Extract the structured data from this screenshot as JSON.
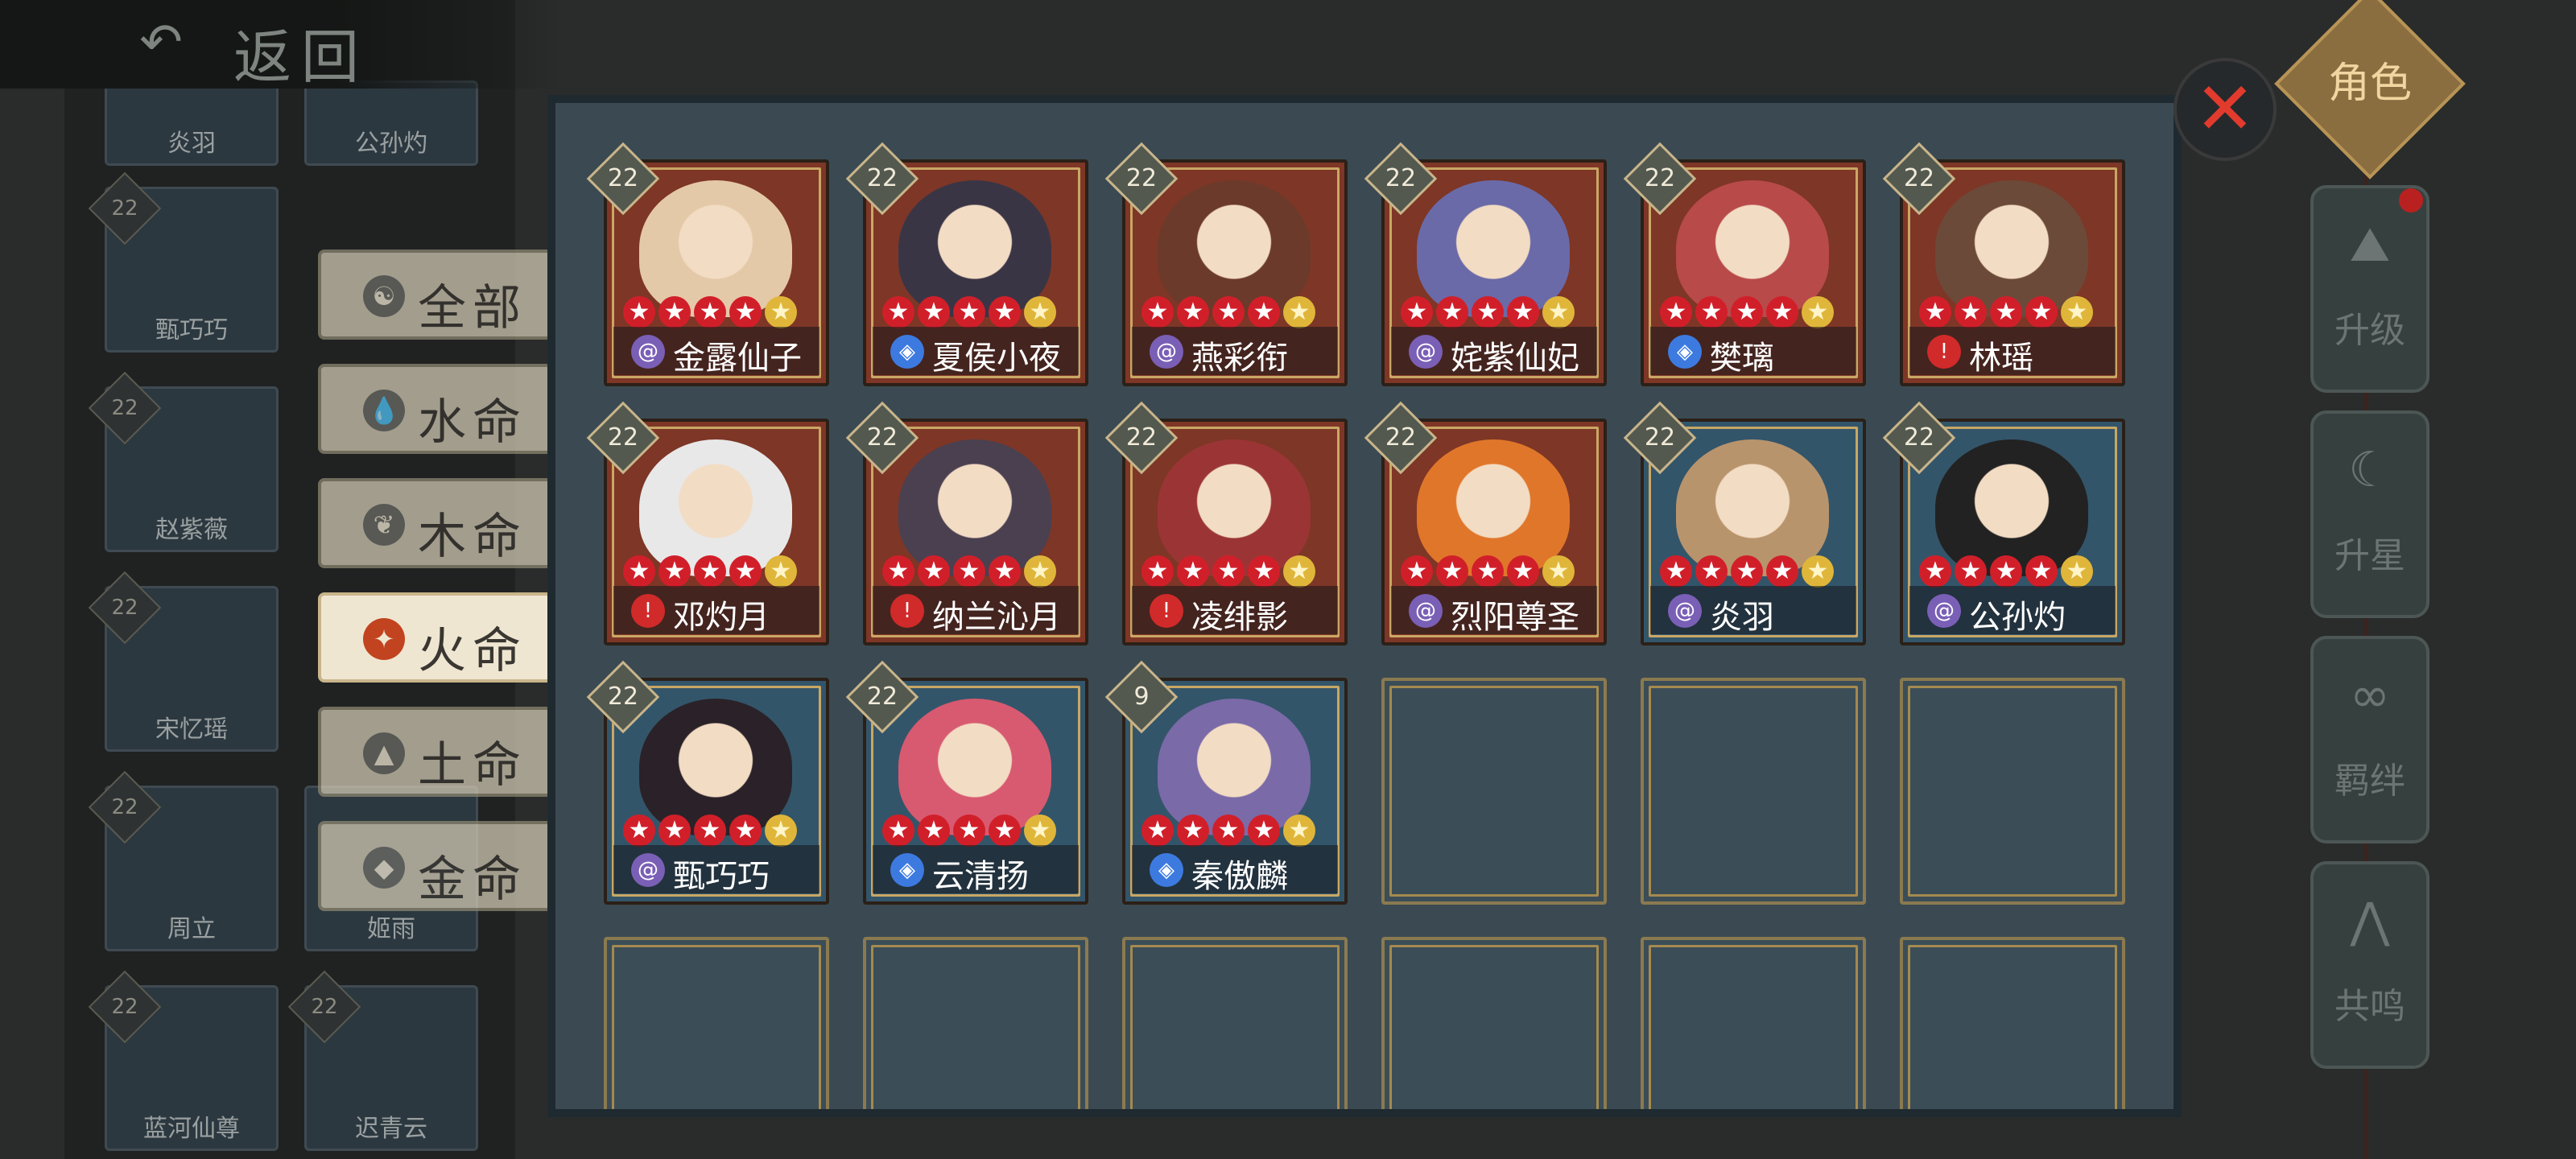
{
  "header": {
    "back_label": "返回"
  },
  "filter_tabs": [
    {
      "label": "全部",
      "icon": "yin-yang-icon",
      "active": false
    },
    {
      "label": "水命",
      "icon": "water-drop-icon",
      "active": false
    },
    {
      "label": "木命",
      "icon": "leaf-icon",
      "active": false
    },
    {
      "label": "火命",
      "icon": "flame-icon",
      "active": true
    },
    {
      "label": "土命",
      "icon": "mountain-icon",
      "active": false
    },
    {
      "label": "金命",
      "icon": "blade-icon",
      "active": false
    }
  ],
  "heroes": [
    {
      "name": "金露仙子",
      "level": "22",
      "element": "purple",
      "bg": "red",
      "red_stars": 4,
      "gold_stars": 1
    },
    {
      "name": "夏侯小夜",
      "level": "22",
      "element": "blue",
      "bg": "red",
      "red_stars": 4,
      "gold_stars": 1
    },
    {
      "name": "燕彩衔",
      "level": "22",
      "element": "purple",
      "bg": "red",
      "red_stars": 4,
      "gold_stars": 1
    },
    {
      "name": "姹紫仙妃",
      "level": "22",
      "element": "purple",
      "bg": "red",
      "red_stars": 4,
      "gold_stars": 1
    },
    {
      "name": "樊璃",
      "level": "22",
      "element": "blue",
      "bg": "red",
      "red_stars": 4,
      "gold_stars": 1
    },
    {
      "name": "林瑶",
      "level": "22",
      "element": "red",
      "bg": "red",
      "red_stars": 4,
      "gold_stars": 1
    },
    {
      "name": "邓灼月",
      "level": "22",
      "element": "red",
      "bg": "red",
      "red_stars": 4,
      "gold_stars": 1
    },
    {
      "name": "纳兰沁月",
      "level": "22",
      "element": "red",
      "bg": "red",
      "red_stars": 4,
      "gold_stars": 1
    },
    {
      "name": "凌绯影",
      "level": "22",
      "element": "red",
      "bg": "red",
      "red_stars": 4,
      "gold_stars": 1
    },
    {
      "name": "烈阳尊圣",
      "level": "22",
      "element": "purple",
      "bg": "red",
      "red_stars": 4,
      "gold_stars": 1
    },
    {
      "name": "炎羽",
      "level": "22",
      "element": "purple",
      "bg": "blue",
      "red_stars": 4,
      "gold_stars": 1
    },
    {
      "name": "公孙灼",
      "level": "22",
      "element": "purple",
      "bg": "blue",
      "red_stars": 4,
      "gold_stars": 1
    },
    {
      "name": "甄巧巧",
      "level": "22",
      "element": "purple",
      "bg": "blue",
      "red_stars": 4,
      "gold_stars": 1
    },
    {
      "name": "云清扬",
      "level": "22",
      "element": "blue",
      "bg": "blue",
      "red_stars": 4,
      "gold_stars": 1
    },
    {
      "name": "秦傲麟",
      "level": "9",
      "element": "blue",
      "bg": "blue",
      "red_stars": 4,
      "gold_stars": 1
    }
  ],
  "empty_slots": 9,
  "background_heroes": [
    {
      "name": "炎羽"
    },
    {
      "name": "公孙灼"
    },
    {
      "name": "甄巧巧"
    },
    {
      "name": "赵紫薇"
    },
    {
      "name": "宋忆瑶"
    },
    {
      "name": "周立"
    },
    {
      "name": "姬雨"
    },
    {
      "name": "蓝河仙尊"
    },
    {
      "name": "迟青云"
    }
  ],
  "right_menu": {
    "role_label": "角色",
    "items": [
      {
        "label": "升级",
        "icon": "level-up-icon"
      },
      {
        "label": "升星",
        "icon": "star-up-icon"
      },
      {
        "label": "羁绊",
        "icon": "bond-icon"
      },
      {
        "label": "共鸣",
        "icon": "resonance-icon"
      }
    ]
  },
  "colors": {
    "element_purple": "#7a5fb6",
    "element_blue": "#3d7ae0",
    "element_red": "#d12a2a",
    "star_red": "#d11f2a",
    "star_gold": "#e0b63a",
    "panel_bg": "#3b4a52",
    "card_red_bg": "#7e3626",
    "card_blue_bg": "#33556a"
  }
}
